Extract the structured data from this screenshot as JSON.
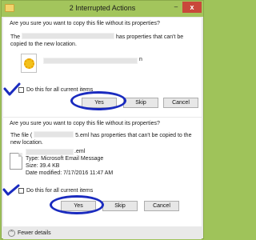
{
  "window": {
    "title": "2 Interrupted Actions",
    "minimize_glyph": "–",
    "close_glyph": "x",
    "accent_color": "#a3c55c"
  },
  "item1": {
    "question": "Are you sure you want to copy this file without its properties?",
    "line1_prefix": "The",
    "line1_suffix": "has properties that can't be",
    "line2": "copied to the new location.",
    "filename_end": "n",
    "checkbox_label": "Do this for all current items",
    "checkbox_checked": false,
    "yes_label": "Yes",
    "skip_label": "Skip",
    "cancel_label": "Cancel"
  },
  "item2": {
    "question": "Are you sure you want to copy this file without its properties?",
    "line1_prefix": "The file (",
    "line1_suffix": "5.eml has properties that can't be copied to the",
    "line2": "new location.",
    "file_ext": ".eml",
    "type": "Type: Microsoft Email Message",
    "size": "Size: 39.4 KB",
    "modified": "Date modified: 7/17/2016 11:47 AM",
    "checkbox_label": "Do this for all current items",
    "checkbox_checked": false,
    "yes_label": "Yes",
    "skip_label": "Skip",
    "cancel_label": "Cancel"
  },
  "footer": {
    "toggle_label": "Fewer details",
    "chevron_glyph": "^"
  },
  "annotation_color": "#1a2bbf"
}
